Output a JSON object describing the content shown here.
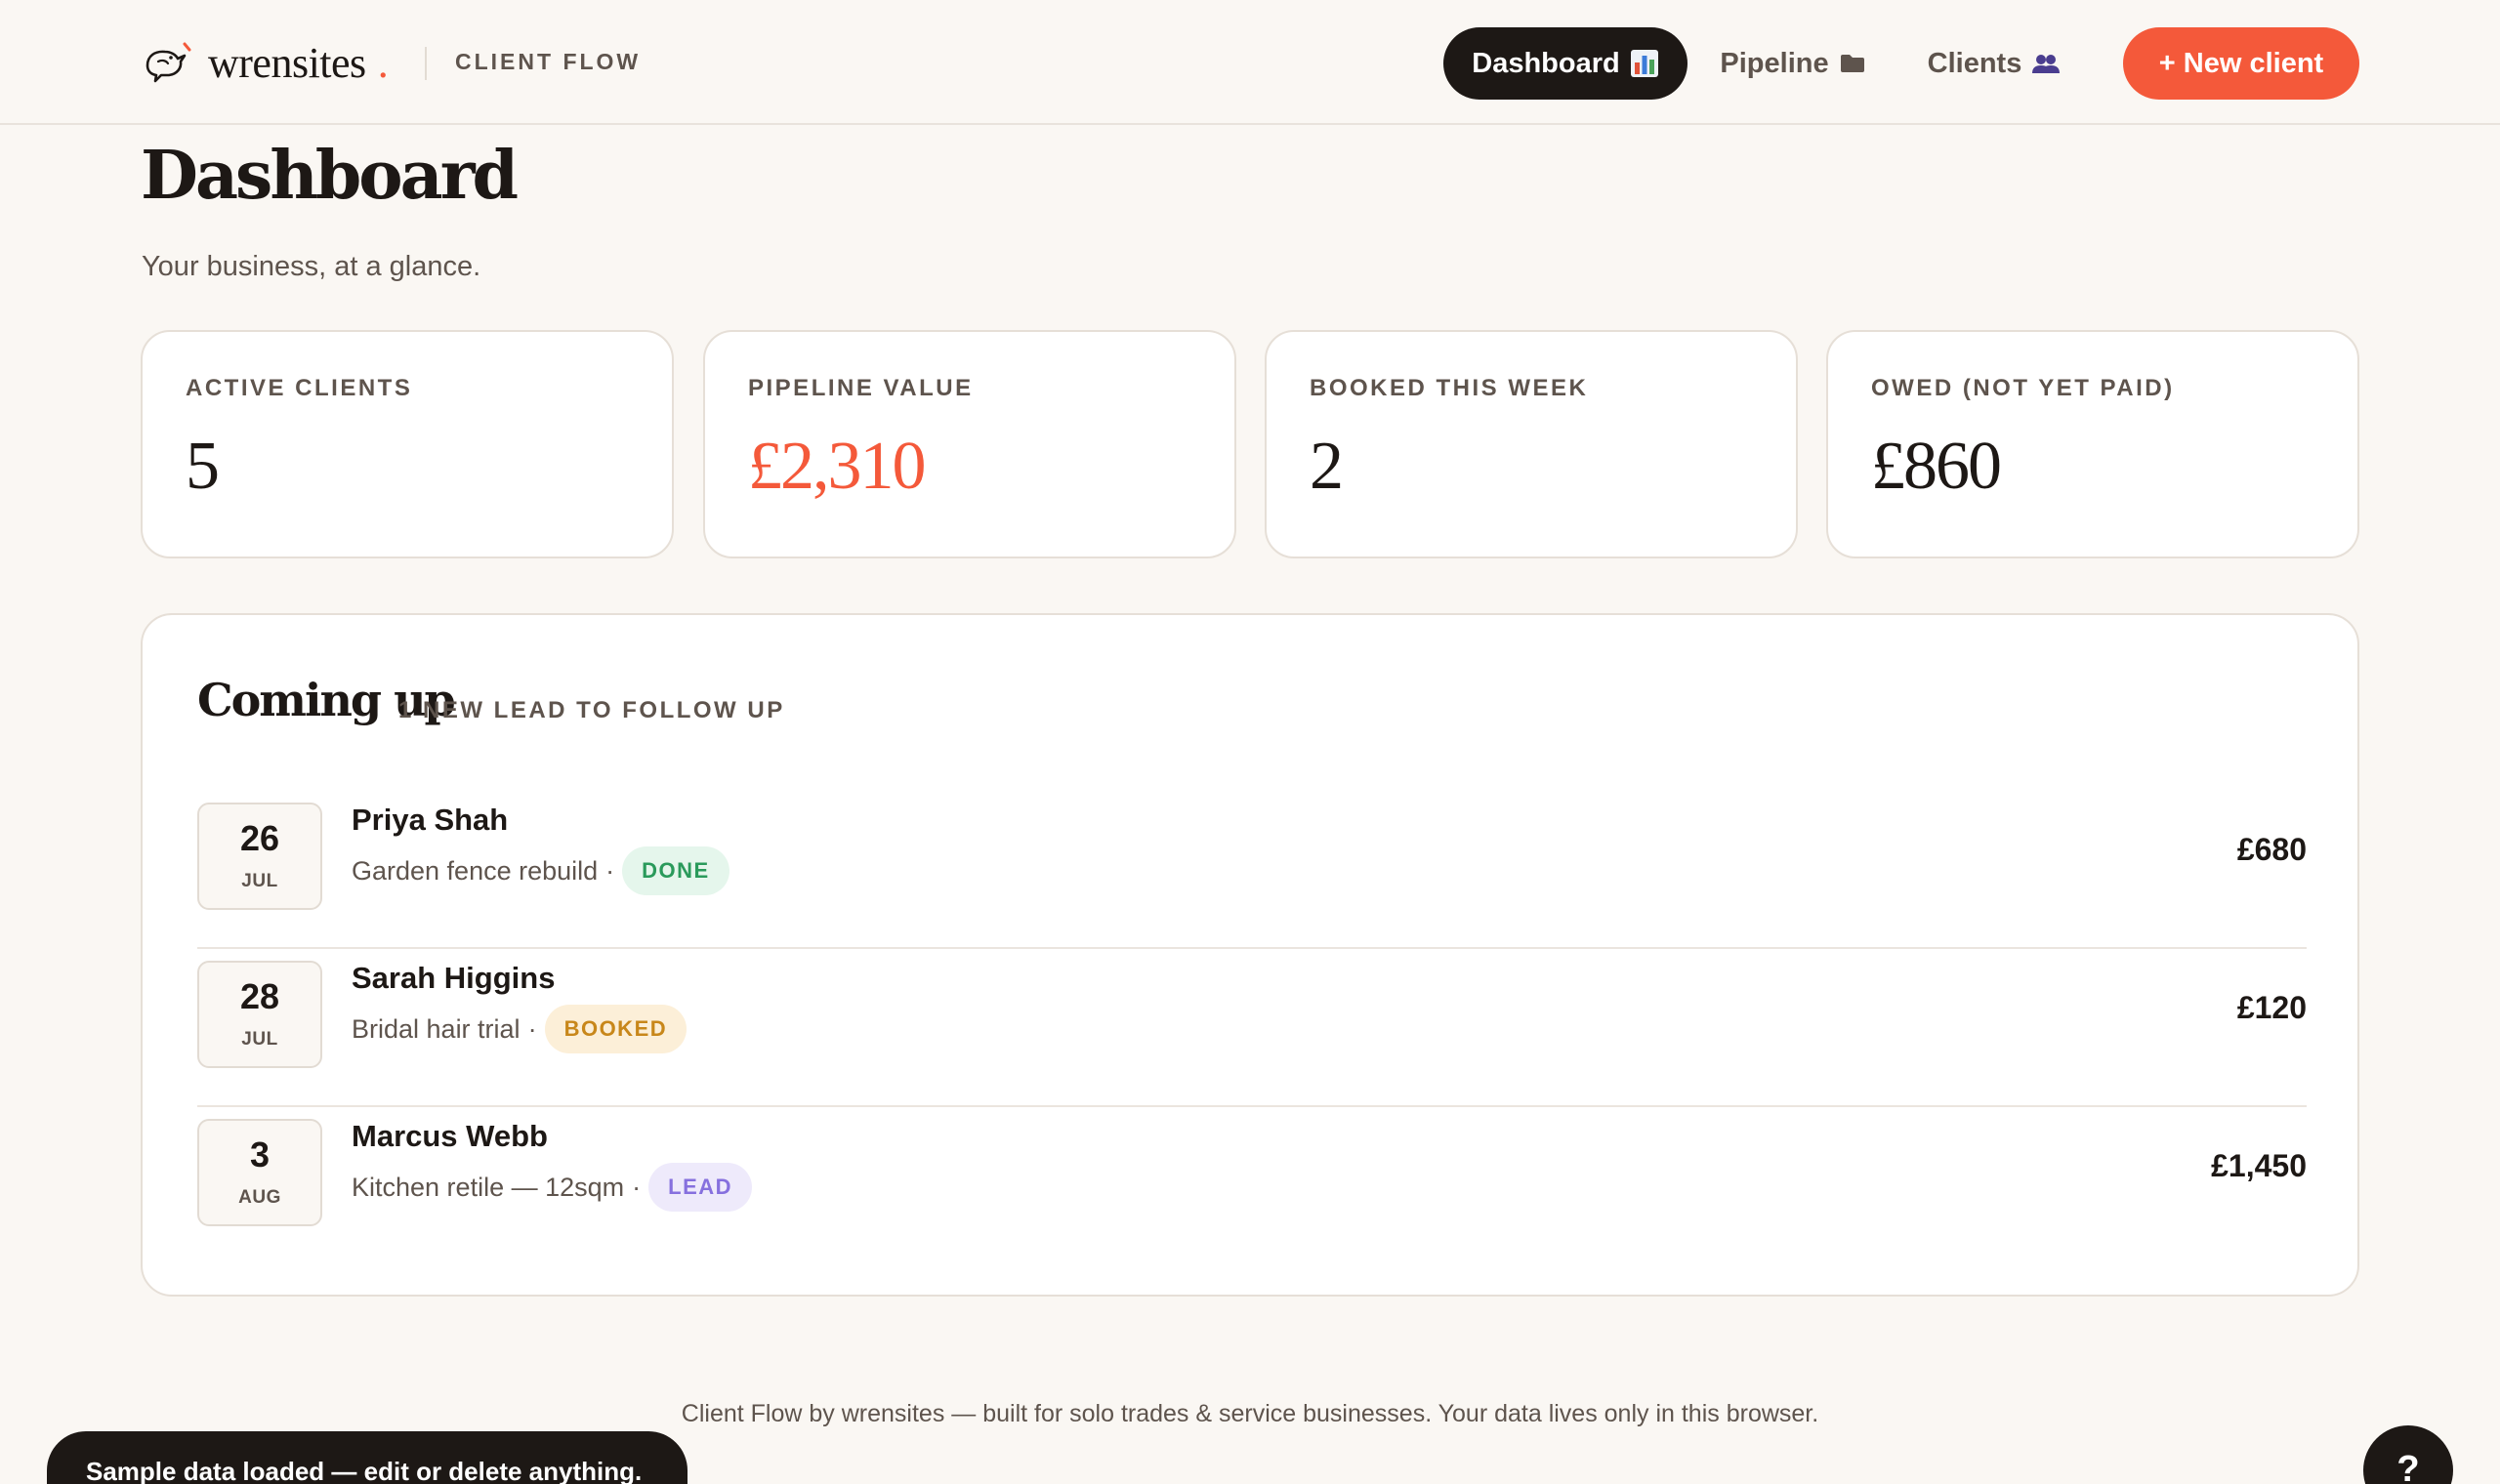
{
  "header": {
    "brand_name": "wrensites",
    "brand_dot": ".",
    "brand_sub": "CLIENT FLOW",
    "nav": [
      {
        "label": "Dashboard",
        "icon": "bar-chart-icon",
        "active": true
      },
      {
        "label": "Pipeline",
        "icon": "folder-icon",
        "active": false
      },
      {
        "label": "Clients",
        "icon": "people-icon",
        "active": false
      }
    ],
    "new_client_label": "+ New client"
  },
  "page": {
    "title": "Dashboard",
    "subtitle": "Your business, at a glance."
  },
  "stats": [
    {
      "label": "ACTIVE CLIENTS",
      "value": "5"
    },
    {
      "label": "PIPELINE VALUE",
      "value": "£2,310"
    },
    {
      "label": "BOOKED THIS WEEK",
      "value": "2"
    },
    {
      "label": "OWED (NOT YET PAID)",
      "value": "£860"
    }
  ],
  "coming_up": {
    "title": "Coming up",
    "badge": "1 NEW LEAD TO FOLLOW UP",
    "items": [
      {
        "day": "26",
        "month": "JUL",
        "name": "Priya Shah",
        "description": "Garden fence rebuild",
        "separator": "·",
        "status": "DONE",
        "amount": "£680"
      },
      {
        "day": "28",
        "month": "JUL",
        "name": "Sarah Higgins",
        "description": "Bridal hair trial",
        "separator": "·",
        "status": "BOOKED",
        "amount": "£120"
      },
      {
        "day": "3",
        "month": "AUG",
        "name": "Marcus Webb",
        "description": "Kitchen retile — 12sqm",
        "separator": "·",
        "status": "LEAD",
        "amount": "£1,450"
      }
    ]
  },
  "footer": {
    "text": "Client Flow by wrensites — built for solo trades & service businesses. Your data lives only in this browser."
  },
  "toast": {
    "text": "Sample data loaded — edit or delete anything."
  },
  "help": {
    "label": "?"
  },
  "colors": {
    "accent": "#f4593a",
    "ink": "#1d1815",
    "done": "#2a9a5b",
    "booked": "#c8871a",
    "lead": "#8670de"
  }
}
